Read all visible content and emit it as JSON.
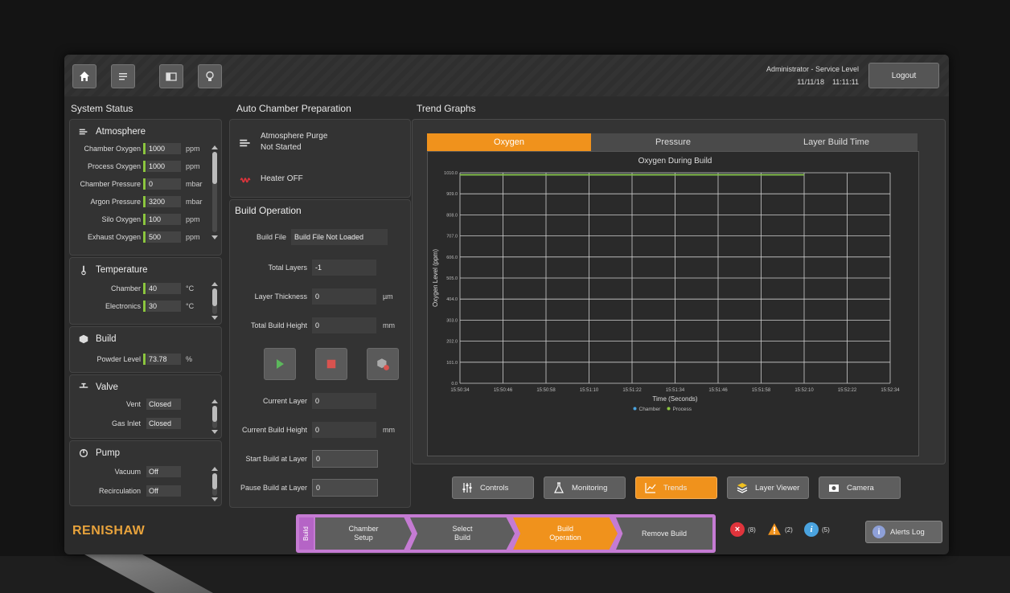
{
  "topbar": {
    "user": "Administrator - Service Level",
    "date": "11/11/18",
    "time": "11:11:11",
    "logout": "Logout",
    "buttons": [
      "home-icon",
      "menu-icon",
      "panel-icon",
      "lightbulb-icon"
    ]
  },
  "system_status": {
    "title": "System Status",
    "atmosphere": {
      "title": "Atmosphere",
      "rows": [
        {
          "label": "Chamber Oxygen",
          "value": "1000",
          "unit": "ppm"
        },
        {
          "label": "Process Oxygen",
          "value": "1000",
          "unit": "ppm"
        },
        {
          "label": "Chamber Pressure",
          "value": "0",
          "unit": "mbar"
        },
        {
          "label": "Argon Pressure",
          "value": "3200",
          "unit": "mbar"
        },
        {
          "label": "Silo Oxygen",
          "value": "100",
          "unit": "ppm"
        },
        {
          "label": "Exhaust Oxygen",
          "value": "500",
          "unit": "ppm"
        }
      ]
    },
    "temperature": {
      "title": "Temperature",
      "rows": [
        {
          "label": "Chamber",
          "value": "40",
          "unit": "°C"
        },
        {
          "label": "Electronics",
          "value": "30",
          "unit": "°C"
        }
      ]
    },
    "build": {
      "title": "Build",
      "rows": [
        {
          "label": "Powder Level",
          "value": "73.78",
          "unit": "%"
        }
      ]
    },
    "valve": {
      "title": "Valve",
      "rows": [
        {
          "label": "Vent",
          "value": "Closed"
        },
        {
          "label": "Gas Inlet",
          "value": "Closed"
        }
      ]
    },
    "pump": {
      "title": "Pump",
      "rows": [
        {
          "label": "Vacuum",
          "value": "Off"
        },
        {
          "label": "Recirculation",
          "value": "Off"
        }
      ]
    }
  },
  "auto_chamber": {
    "title": "Auto Chamber Preparation",
    "purge_label": "Atmosphere Purge",
    "purge_status": "Not Started",
    "heater": "Heater OFF"
  },
  "build_operation": {
    "title": "Build Operation",
    "build_file_label": "Build File",
    "build_file_value": "Build File Not Loaded",
    "total_layers_label": "Total Layers",
    "total_layers_value": "-1",
    "layer_thickness_label": "Layer Thickness",
    "layer_thickness_value": "0",
    "layer_thickness_unit": "µm",
    "total_build_height_label": "Total Build Height",
    "total_build_height_value": "0",
    "total_build_height_unit": "mm",
    "current_layer_label": "Current Layer",
    "current_layer_value": "0",
    "current_build_height_label": "Current Build Height",
    "current_build_height_value": "0",
    "current_build_height_unit": "mm",
    "start_layer_label": "Start Build at Layer",
    "start_layer_value": "0",
    "pause_layer_label": "Pause Build at Layer",
    "pause_layer_value": "0"
  },
  "trends": {
    "title": "Trend Graphs",
    "tabs": [
      "Oxygen",
      "Pressure",
      "Layer Build Time"
    ],
    "active_tab": 0
  },
  "chart_data": {
    "type": "line",
    "title": "Oxygen During Build",
    "xlabel": "Time (Seconds)",
    "ylabel": "Oxygen Level (ppm)",
    "x": [
      "15:50:34",
      "15:50:46",
      "15:50:58",
      "15:51:10",
      "15:51:22",
      "15:51:34",
      "15:51:46",
      "15:51:58",
      "15:52:10",
      "15:52:22",
      "15:52:34"
    ],
    "y_ticks": [
      "0.0",
      "101.0",
      "202.0",
      "303.0",
      "404.0",
      "505.0",
      "606.0",
      "707.0",
      "808.0",
      "909.0",
      "1010.0"
    ],
    "ylim": [
      0,
      1010
    ],
    "grid": true,
    "legend_position": "bottom",
    "series": [
      {
        "name": "Chamber",
        "color": "#4aa3df",
        "values": [
          1000,
          1000,
          1000,
          1000,
          1000,
          1000,
          1000,
          1000,
          1000
        ]
      },
      {
        "name": "Process",
        "color": "#8cc63f",
        "values": [
          1000,
          1000,
          1000,
          1000,
          1000,
          1000,
          1000,
          1000,
          1000
        ]
      }
    ]
  },
  "bottom_nav": [
    {
      "label": "Controls",
      "icon": "sliders-icon"
    },
    {
      "label": "Monitoring",
      "icon": "flask-icon"
    },
    {
      "label": "Trends",
      "icon": "trend-icon",
      "active": true
    },
    {
      "label": "Layer Viewer",
      "icon": "layers-icon"
    },
    {
      "label": "Camera",
      "icon": "camera-icon"
    }
  ],
  "workflow": {
    "tag": "Build",
    "steps": [
      "Chamber Setup",
      "Select Build",
      "Build Operation",
      "Remove Build"
    ],
    "active_step": 2
  },
  "footer": {
    "logo": "RENISHAW",
    "errors": "(8)",
    "warnings": "(2)",
    "info": "(5)",
    "alerts_log": "Alerts Log",
    "error_color": "#e0343c",
    "warning_color": "#f0921c",
    "info_color": "#4aa3df"
  }
}
